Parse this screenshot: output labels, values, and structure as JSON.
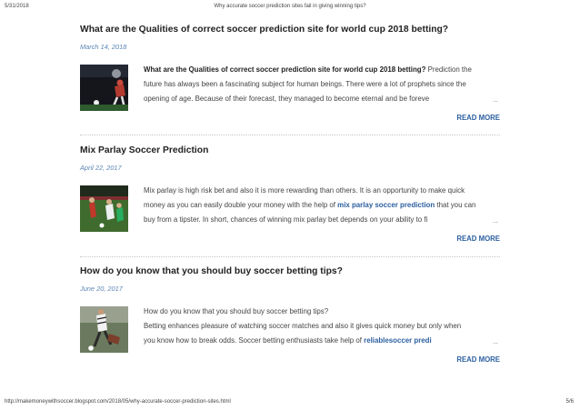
{
  "print_header": {
    "date": "5/31/2018",
    "title": "Why accurate soccer prediction sites fail in giving winning tips?"
  },
  "posts": [
    {
      "title": "What are the Qualities of correct soccer prediction site for world cup 2018 betting?",
      "date": "March 14, 2018",
      "excerpt": {
        "bold_lead": "What are the Qualities of correct soccer prediction site for world cup 2018 betting?",
        "line1_rest": " Prediction the",
        "line2": "future has always been a fascinating subject for human beings. There were a lot of prophets since the",
        "line3": "opening of age. Because of their forecast, they managed to become eternal and be foreve"
      },
      "ellipsis": "...",
      "read_more": "READ MORE",
      "thumbnail_icon": "soccer-player-night-photo"
    },
    {
      "title": "Mix Parlay Soccer Prediction",
      "date": "April 22, 2017",
      "excerpt": {
        "line1": "Mix parlay is high risk bet and also it is more rewarding than others. It is an opportunity to make quick",
        "line2_before": "money as you can easily double your money with the help of ",
        "line2_link": "mix parlay soccer prediction",
        "line2_after": " that you can",
        "line3": "buy from a tipster. In short, chances of winning mix parlay bet depends on your ability to fi"
      },
      "ellipsis": "...",
      "read_more": "READ MORE",
      "thumbnail_icon": "soccer-match-photo"
    },
    {
      "title": "How do you know that you should buy soccer betting tips?",
      "date": "June 20, 2017",
      "excerpt": {
        "line1": "How do you know that you should buy soccer betting tips?",
        "line2": "Betting enhances pleasure of watching soccer matches and also it gives quick money but only when",
        "line3_before": "you know how to break odds. Soccer betting enthusiasts take help of ",
        "line3_link": "reliablesoccer predi"
      },
      "ellipsis": "...",
      "read_more": "READ MORE",
      "thumbnail_icon": "soccer-tackle-photo"
    }
  ],
  "print_footer": {
    "url": "http://makemoneywithsoccer.blogspot.com/2018/05/why-accurate-soccer-prediction-sites.html",
    "page": "5/6"
  }
}
